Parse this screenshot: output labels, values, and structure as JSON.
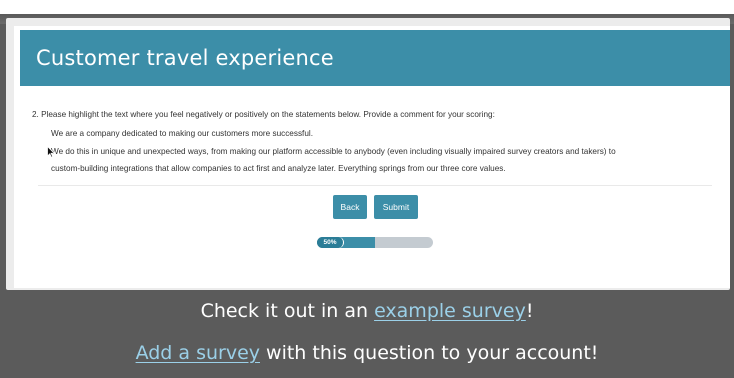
{
  "survey": {
    "title": "Customer travel experience",
    "question": "2. Please highlight the text where you feel negatively or positively on the statements below. Provide a comment for your scoring:",
    "statements": [
      "We are a company dedicated to making our customers more successful.",
      "We do this in unique and unexpected ways, from making our platform accessible to anybody (even including visually impaired survey creators and takers) to",
      "custom-building integrations that allow companies to act first and analyze later. Everything springs from our three core values."
    ],
    "back_label": "Back",
    "submit_label": "Submit",
    "progress": {
      "percent": 50,
      "label": "50%"
    }
  },
  "promo": {
    "line1_prefix": "Check it out in an ",
    "line1_link": "example survey",
    "line1_suffix": "!",
    "line2_link": "Add a survey",
    "line2_suffix": " with this question to your account!"
  },
  "colors": {
    "accent": "#3c8ea8",
    "background": "#5b5b5b",
    "link": "#9bd0e8"
  },
  "icons": [
    "mouse-cursor-icon"
  ]
}
